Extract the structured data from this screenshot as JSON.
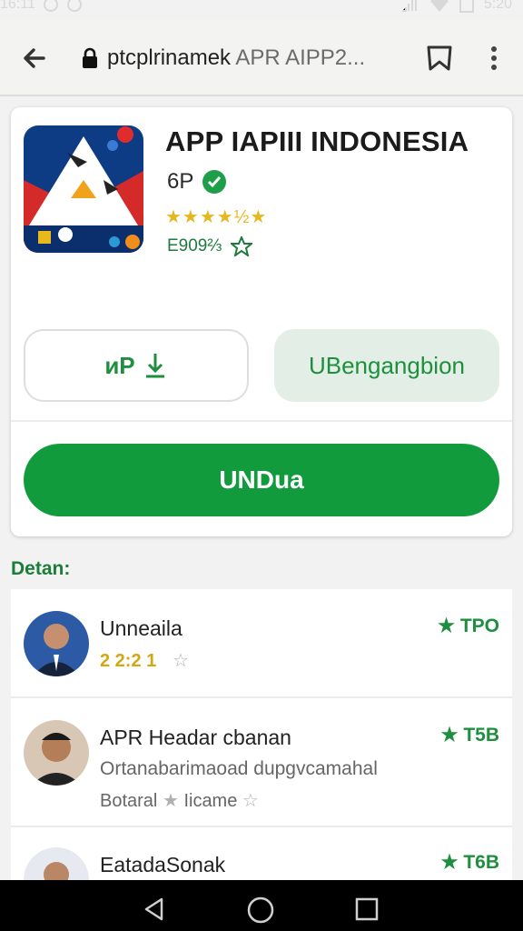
{
  "status_bar": {
    "time": "16:11",
    "battery": "5:20"
  },
  "browser": {
    "url": "ptcplrinamek",
    "url_suffix": "APR AIPP2..."
  },
  "app": {
    "title": "APP IAPIII INDONESIA",
    "developer": "6P",
    "rating": "★★★★½★",
    "downloads": "E909⅔",
    "btn_install": "ᴎP",
    "btn_secondary": "UBengangbion",
    "btn_primary": "UNDua"
  },
  "section": {
    "title": "Detan:"
  },
  "reviews": [
    {
      "name": "Unneaila",
      "rating": "2 2:2 1",
      "score": "TPO"
    },
    {
      "name": "APR Headar cbanan",
      "subtitle": "Ortanabarimaoad dupgvcamahal",
      "meta": "Botaral",
      "meta2": "Iicame",
      "score": "T5B"
    },
    {
      "name": "EatadaSonak",
      "score": "T6B"
    }
  ],
  "colors": {
    "primary": "#119b3d",
    "text_green": "#1e8f3e",
    "star": "#e5b81f"
  },
  "icons": [
    "back-arrow-icon",
    "lock-icon",
    "bookmark-icon",
    "menu-dots-icon",
    "verified-icon",
    "star-icon",
    "download-icon"
  ]
}
